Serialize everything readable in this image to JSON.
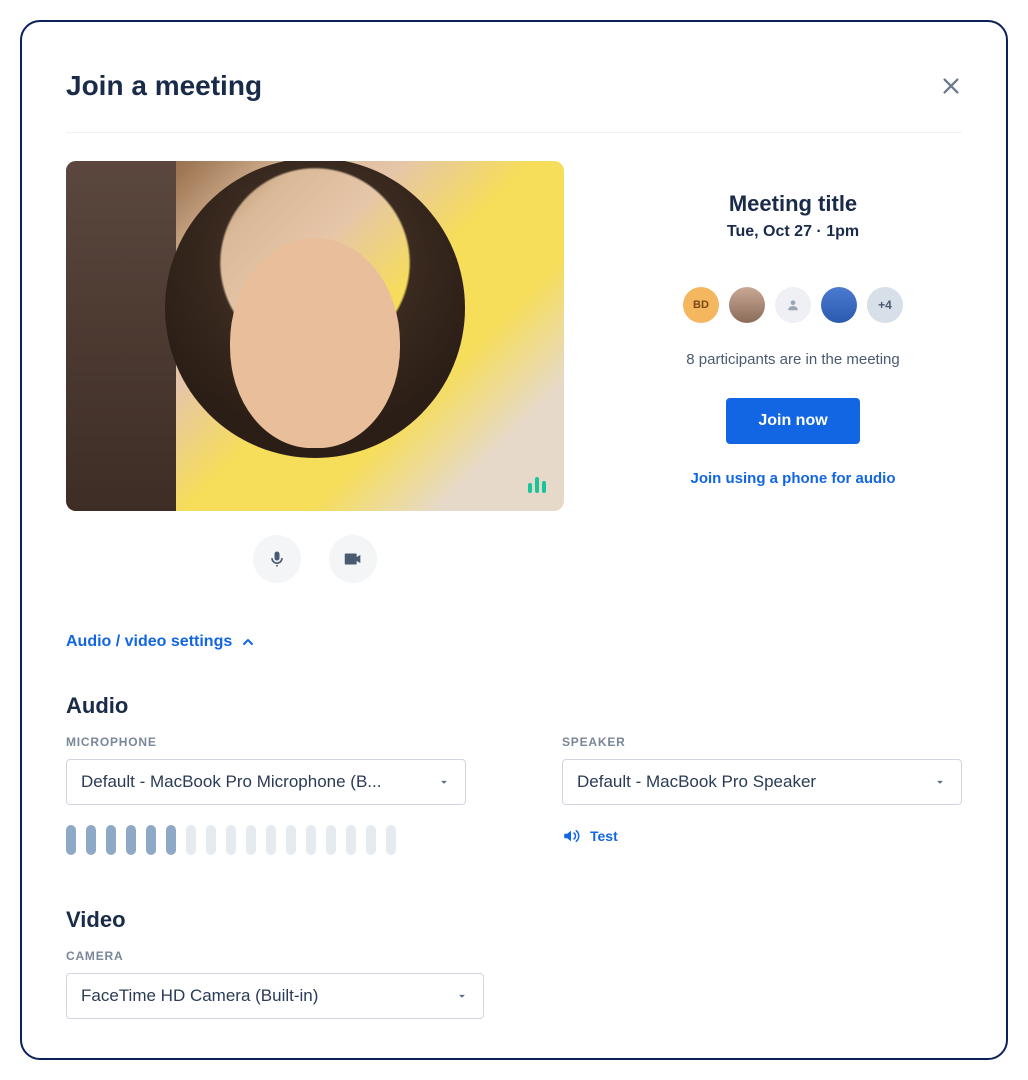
{
  "modal": {
    "title": "Join a meeting"
  },
  "meeting": {
    "title": "Meeting title",
    "datetime": "Tue, Oct 27 · 1pm",
    "participants_text": "8 participants are in the meeting",
    "join_label": "Join now",
    "phone_link": "Join using a phone for audio",
    "avatars": {
      "bd": "BD",
      "more": "+4"
    }
  },
  "av_toggle": "Audio / video settings",
  "audio": {
    "section": "Audio",
    "mic_label": "MICROPHONE",
    "mic_value": "Default - MacBook Pro Microphone (B...",
    "speaker_label": "SPEAKER",
    "speaker_value": "Default - MacBook Pro Speaker",
    "test_label": "Test",
    "level_active_bars": 6,
    "level_total_bars": 17
  },
  "video": {
    "section": "Video",
    "camera_label": "CAMERA",
    "camera_value": "FaceTime HD Camera (Built-in)"
  }
}
